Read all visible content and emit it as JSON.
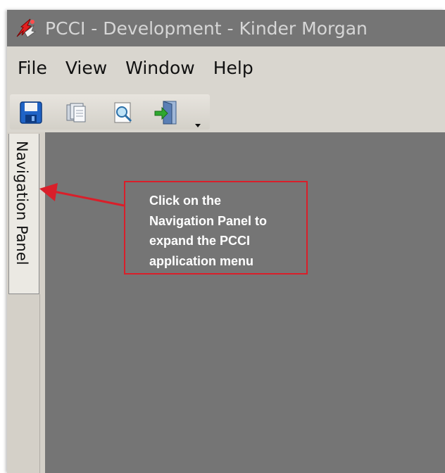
{
  "window": {
    "title": "PCCI - Development - Kinder Morgan"
  },
  "menu": {
    "items": [
      {
        "label": "File"
      },
      {
        "label": "View"
      },
      {
        "label": "Window"
      },
      {
        "label": "Help"
      }
    ]
  },
  "toolbar": {
    "buttons": [
      {
        "icon": "save-icon"
      },
      {
        "icon": "copy-pages-icon"
      },
      {
        "icon": "print-preview-icon"
      },
      {
        "icon": "exit-door-icon"
      }
    ]
  },
  "navigation_panel": {
    "label": "Navigation Panel"
  },
  "callout": {
    "lines": [
      "Click on the",
      "Navigation Panel to",
      "expand the PCCI",
      "application menu"
    ],
    "color": "#d91f2a"
  }
}
